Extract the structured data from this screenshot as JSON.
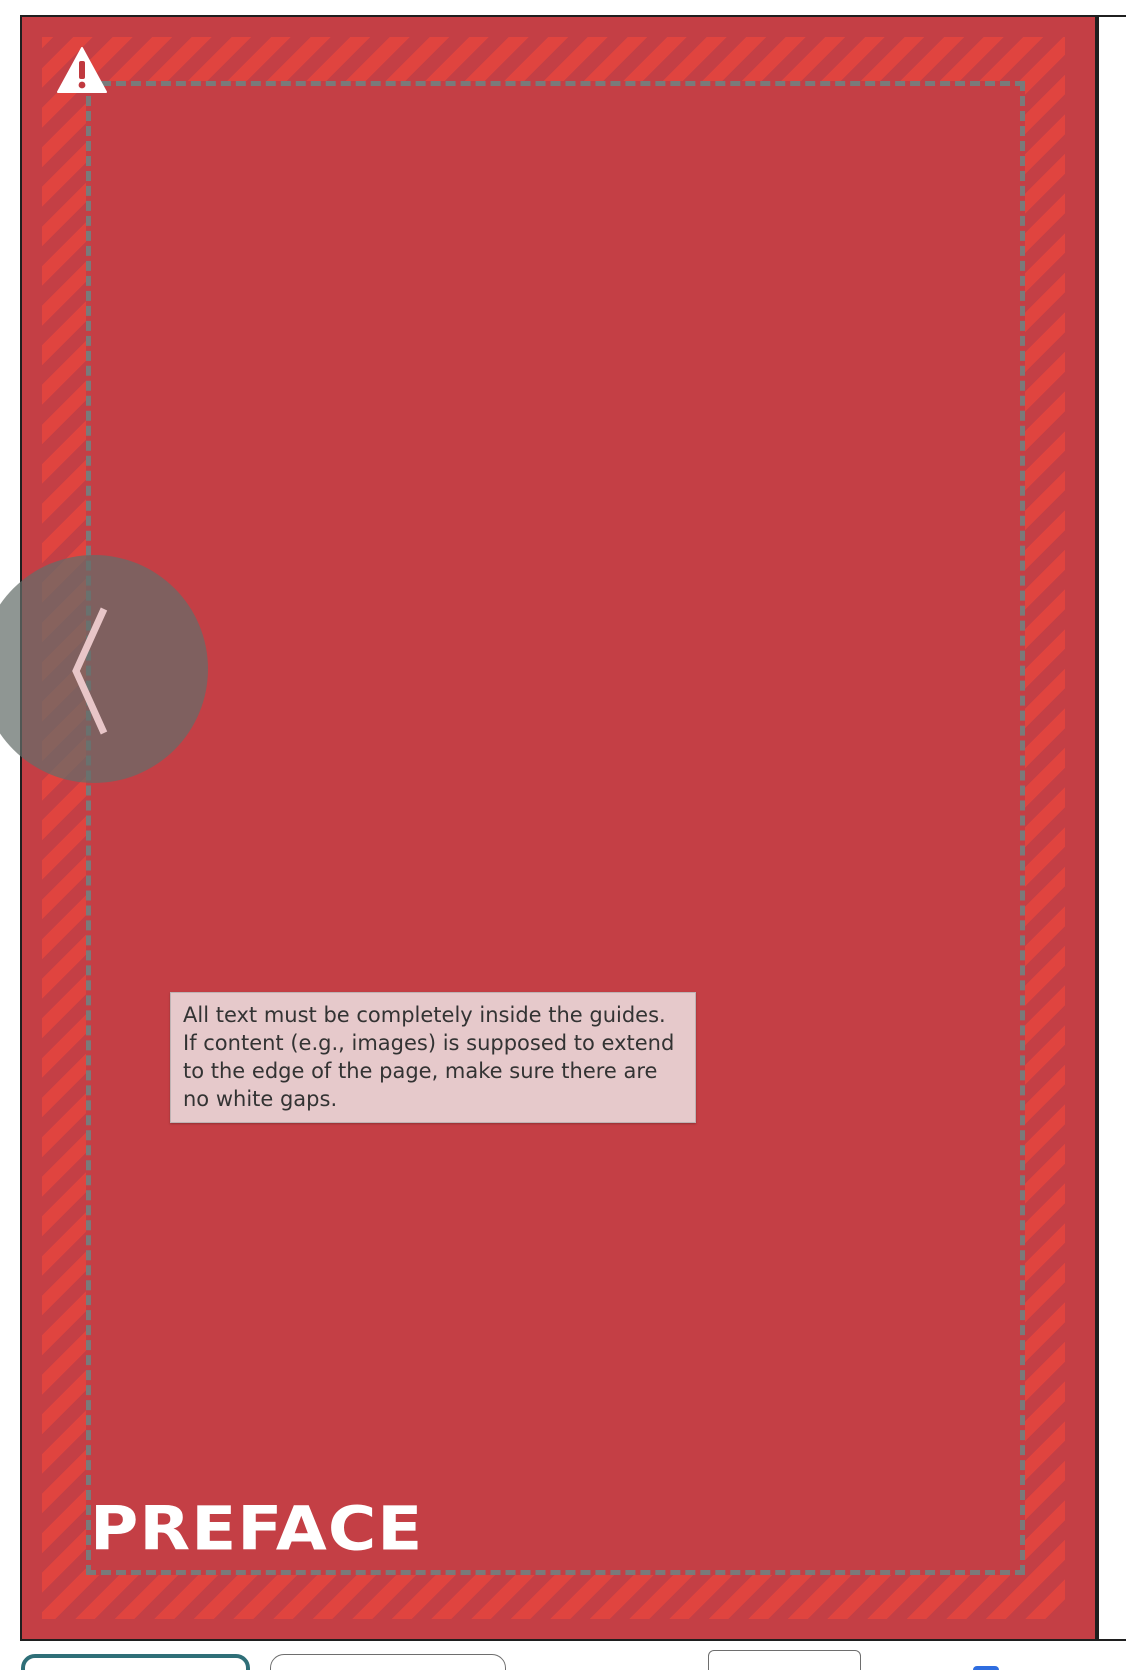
{
  "editor": {
    "page_label": "PREFACE",
    "guide_tooltip": "All text must be completely inside the guides. If content (e.g., images) is supposed to extend to the edge of the page, make sure there are no white gaps.",
    "warning_icon": "warning-triangle-icon",
    "prev_icon": "chevron-left-icon"
  },
  "colors": {
    "page_background": "#c43f45",
    "bleed_stripe": "#e0443f",
    "guide_line": "#7a7a7a",
    "tooltip_background": "#e6c9cb",
    "primary_button_border": "#2f6f78",
    "checkbox_accent": "#2e6de0"
  }
}
